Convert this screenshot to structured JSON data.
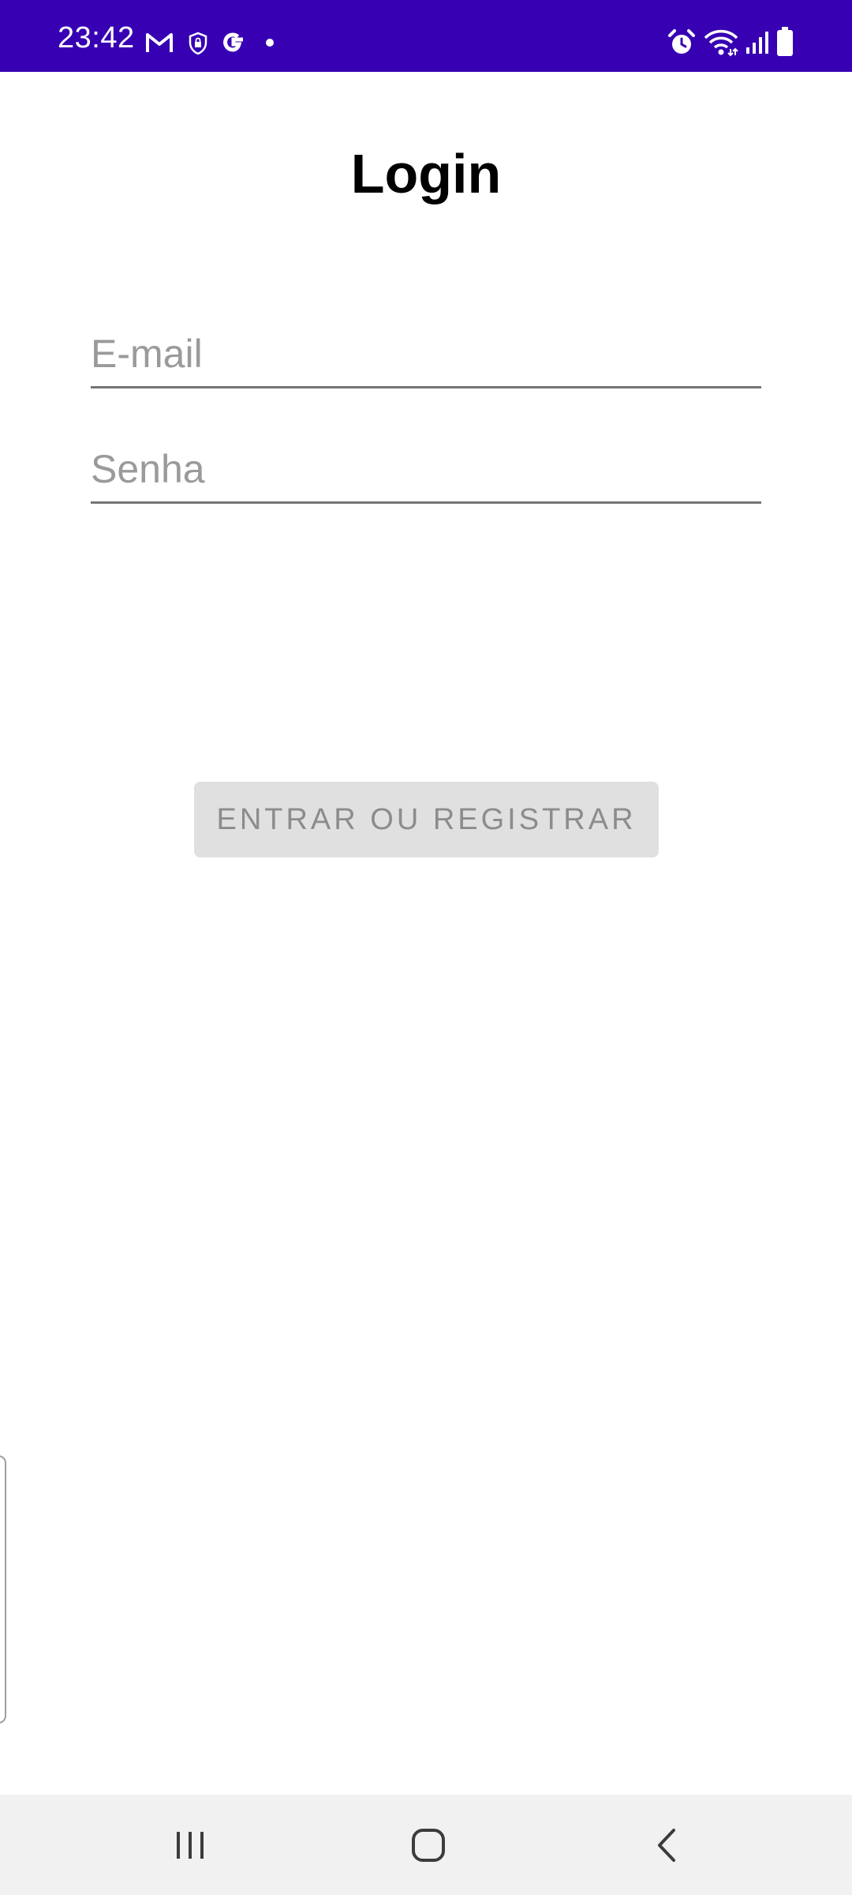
{
  "status_bar": {
    "time": "23:42",
    "background": "#3700b3",
    "left_icons": [
      "gmail-icon",
      "vpn-shield-icon",
      "google-icon",
      "notification-dot-icon"
    ],
    "right_icons": [
      "alarm-icon",
      "wifi-icon",
      "signal-icon",
      "battery-icon"
    ]
  },
  "page": {
    "title": "Login"
  },
  "form": {
    "email_placeholder": "E-mail",
    "email_value": "",
    "password_placeholder": "Senha",
    "password_value": "",
    "submit_label": "ENTRAR OU REGISTRAR",
    "submit_enabled": false
  },
  "nav_bar": {
    "buttons": [
      "recent-apps-icon",
      "home-icon",
      "back-icon"
    ]
  }
}
